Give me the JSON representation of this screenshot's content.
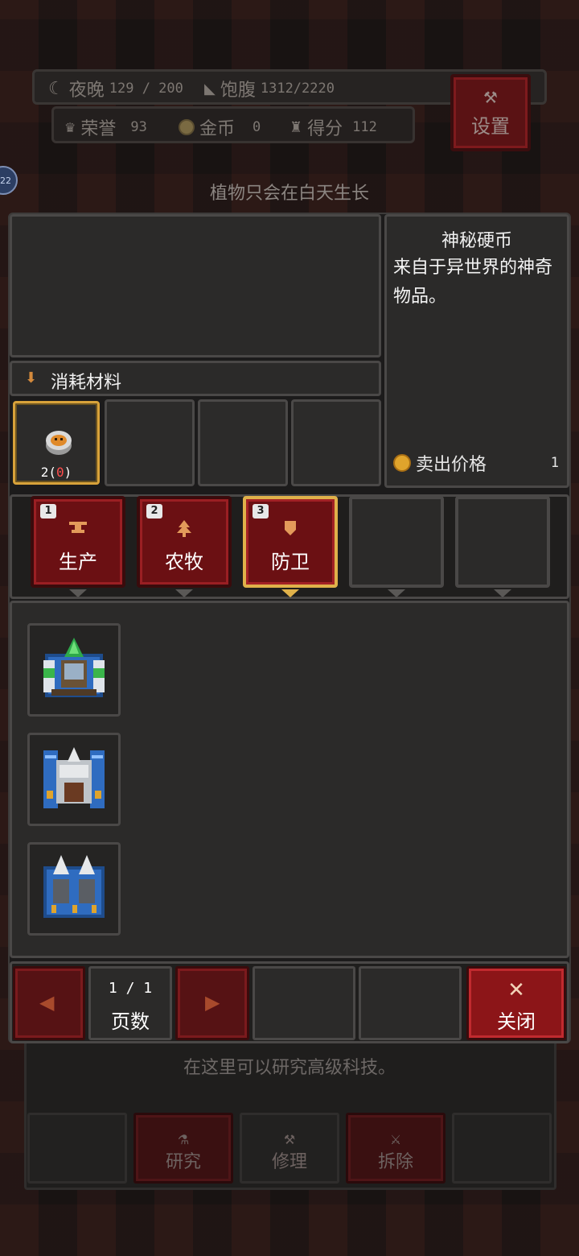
{
  "status": {
    "night_label": "夜晚",
    "night_value": "129 / 200",
    "satiety_label": "饱腹",
    "satiety_value": "1312/2220",
    "honor_label": "荣誉",
    "honor_value": "93",
    "gold_label": "金币",
    "gold_value": "0",
    "score_label": "得分",
    "score_value": "112",
    "settings_label": "设置",
    "badge_value": "22"
  },
  "hint_text": "植物只会在白天生长",
  "materials": {
    "header": "消耗材料",
    "slot_count": "2(0)"
  },
  "item_info": {
    "name": "神秘硬币",
    "description": "来自于异世界的神奇物品。",
    "sell_label": "卖出价格",
    "sell_value": "1"
  },
  "tabs": [
    {
      "key": "1",
      "label": "生产",
      "icon": "anvil-icon"
    },
    {
      "key": "2",
      "label": "农牧",
      "icon": "tree-icon"
    },
    {
      "key": "3",
      "label": "防卫",
      "icon": "shield-icon",
      "selected": true
    }
  ],
  "buildings": [
    "green-turret-icon",
    "blue-cannon-tower-icon",
    "twin-spike-tower-icon"
  ],
  "pager": {
    "page_value": "1 / 1",
    "page_label": "页数",
    "close_label": "关闭"
  },
  "background_panel": {
    "text": "在这里可以研究高级科技。",
    "buttons": [
      "研究",
      "修理",
      "拆除"
    ]
  },
  "colors": {
    "accent_red": "#6b1013",
    "selected_gold": "#e0b14a",
    "panel": "#2b2a29"
  }
}
